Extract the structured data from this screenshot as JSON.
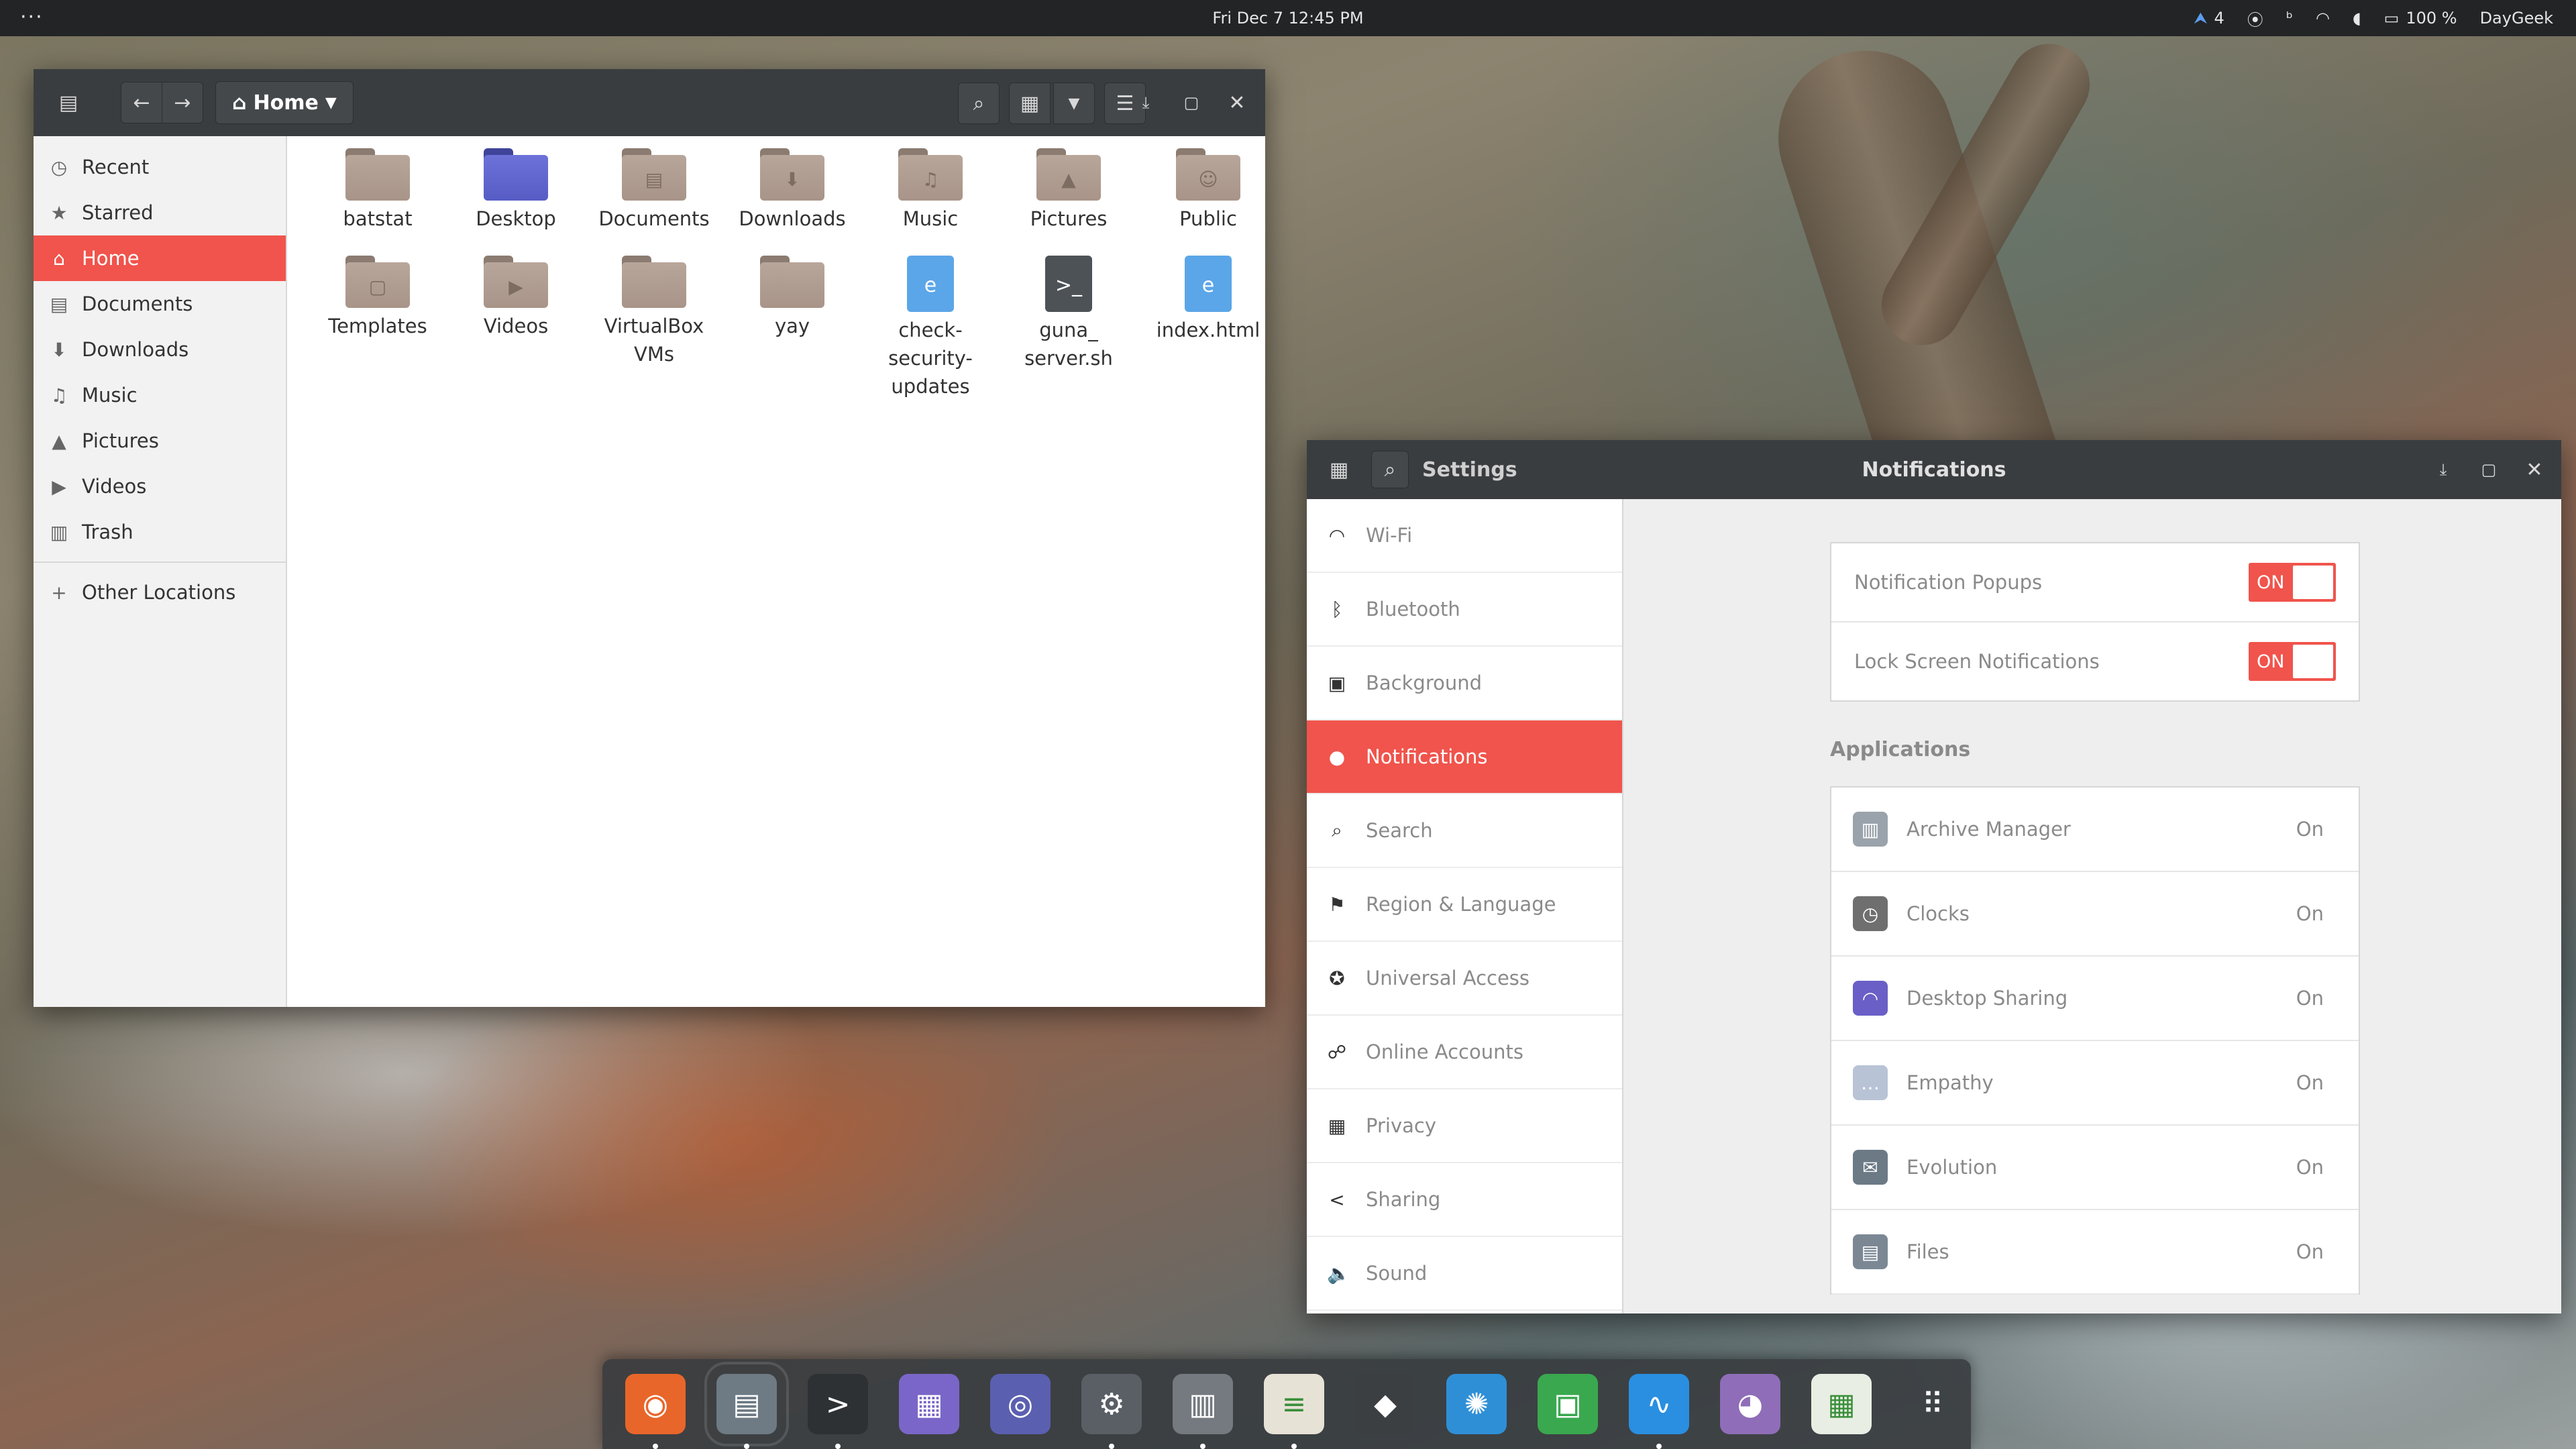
{
  "topbar": {
    "menu_dots": "···",
    "clock": "Fri Dec 7  12:45 PM",
    "tray": {
      "updates_count": "4",
      "battery": "100 %",
      "user": "DayGeek"
    }
  },
  "files": {
    "path_label": "Home",
    "sidebar": [
      {
        "label": "Recent",
        "icon": "clock-icon",
        "glyph": "◷"
      },
      {
        "label": "Starred",
        "icon": "star-icon",
        "glyph": "★"
      },
      {
        "label": "Home",
        "icon": "home-icon",
        "glyph": "⌂",
        "active": true
      },
      {
        "label": "Documents",
        "icon": "document-icon",
        "glyph": "▤"
      },
      {
        "label": "Downloads",
        "icon": "download-icon",
        "glyph": "⬇"
      },
      {
        "label": "Music",
        "icon": "music-icon",
        "glyph": "♫"
      },
      {
        "label": "Pictures",
        "icon": "picture-icon",
        "glyph": "▲"
      },
      {
        "label": "Videos",
        "icon": "video-icon",
        "glyph": "▶"
      },
      {
        "label": "Trash",
        "icon": "trash-icon",
        "glyph": "▥"
      }
    ],
    "other_locations": "Other Locations",
    "items": [
      {
        "name": "batstat",
        "kind": "folder",
        "emblem": ""
      },
      {
        "name": "Desktop",
        "kind": "desktop",
        "emblem": ""
      },
      {
        "name": "Documents",
        "kind": "folder",
        "emblem": "▤"
      },
      {
        "name": "Downloads",
        "kind": "folder",
        "emblem": "⬇"
      },
      {
        "name": "Music",
        "kind": "folder",
        "emblem": "♫"
      },
      {
        "name": "Pictures",
        "kind": "folder",
        "emblem": "▲"
      },
      {
        "name": "Public",
        "kind": "folder",
        "emblem": "☺"
      },
      {
        "name": "Templates",
        "kind": "folder",
        "emblem": "▢"
      },
      {
        "name": "Videos",
        "kind": "folder",
        "emblem": "▶"
      },
      {
        "name": "VirtualBox VMs",
        "kind": "folder",
        "emblem": ""
      },
      {
        "name": "yay",
        "kind": "folder",
        "emblem": ""
      },
      {
        "name": "check-security-updates",
        "kind": "html",
        "emblem": "e"
      },
      {
        "name": "guna_ server.sh",
        "kind": "script",
        "emblem": ">_"
      },
      {
        "name": "index.html",
        "kind": "html",
        "emblem": "e"
      }
    ]
  },
  "settings": {
    "app_title": "Settings",
    "panel_title": "Notifications",
    "nav": [
      {
        "label": "Wi-Fi",
        "icon": "wifi-icon",
        "glyph": "◠"
      },
      {
        "label": "Bluetooth",
        "icon": "bluetooth-icon",
        "glyph": "ᛒ"
      },
      {
        "label": "Background",
        "icon": "background-icon",
        "glyph": "▣"
      },
      {
        "label": "Notifications",
        "icon": "notification-icon",
        "glyph": "●",
        "active": true
      },
      {
        "label": "Search",
        "icon": "search-icon",
        "glyph": "⌕"
      },
      {
        "label": "Region & Language",
        "icon": "region-icon",
        "glyph": "⚑"
      },
      {
        "label": "Universal Access",
        "icon": "accessibility-icon",
        "glyph": "✪"
      },
      {
        "label": "Online Accounts",
        "icon": "online-accounts-icon",
        "glyph": "☍"
      },
      {
        "label": "Privacy",
        "icon": "privacy-icon",
        "glyph": "▦"
      },
      {
        "label": "Sharing",
        "icon": "share-icon",
        "glyph": "<"
      },
      {
        "label": "Sound",
        "icon": "sound-icon",
        "glyph": "🔈"
      }
    ],
    "toggles": [
      {
        "label": "Notification Popups",
        "state": "ON"
      },
      {
        "label": "Lock Screen Notifications",
        "state": "ON"
      }
    ],
    "apps_heading": "Applications",
    "apps": [
      {
        "name": "Archive Manager",
        "state": "On",
        "color": "#9aa3ab",
        "glyph": "▥"
      },
      {
        "name": "Clocks",
        "state": "On",
        "color": "#6f6f6f",
        "glyph": "◷"
      },
      {
        "name": "Desktop Sharing",
        "state": "On",
        "color": "#6a5fc6",
        "glyph": "◠"
      },
      {
        "name": "Empathy",
        "state": "On",
        "color": "#b9c3d6",
        "glyph": "…"
      },
      {
        "name": "Evolution",
        "state": "On",
        "color": "#6c7a86",
        "glyph": "✉"
      },
      {
        "name": "Files",
        "state": "On",
        "color": "#7b8894",
        "glyph": "▤"
      }
    ]
  },
  "dock": [
    {
      "name": "firefox",
      "color": "#e8662a",
      "glyph": "◉",
      "running": true
    },
    {
      "name": "files",
      "color": "#6e7a84",
      "glyph": "▤",
      "running": true
    },
    {
      "name": "terminal",
      "color": "#2e3134",
      "glyph": ">",
      "running": true
    },
    {
      "name": "software-store",
      "color": "#7a66c8",
      "glyph": "▦",
      "running": false
    },
    {
      "name": "disk-usage",
      "color": "#5b5fb0",
      "glyph": "◎",
      "running": false
    },
    {
      "name": "settings",
      "color": "#5a5f66",
      "glyph": "⚙",
      "running": true
    },
    {
      "name": "mixer",
      "color": "#747a80",
      "glyph": "▥",
      "running": true
    },
    {
      "name": "text-editor",
      "color": "#e7e2d6",
      "glyph": "≡",
      "running": true
    },
    {
      "name": "inkscape",
      "color": "#3c3f42",
      "glyph": "◆",
      "running": false
    },
    {
      "name": "shutter",
      "color": "#2f8fd6",
      "glyph": "✺",
      "running": false
    },
    {
      "name": "presentation",
      "color": "#3aa84f",
      "glyph": "▣",
      "running": false
    },
    {
      "name": "system-monitor",
      "color": "#2a8fe0",
      "glyph": "∿",
      "running": true
    },
    {
      "name": "paint",
      "color": "#8f6db8",
      "glyph": "◕",
      "running": false
    },
    {
      "name": "spreadsheet",
      "color": "#e9eee4",
      "glyph": "▦",
      "running": false
    },
    {
      "name": "app-grid",
      "color": "transparent",
      "glyph": "⠿",
      "running": false
    }
  ]
}
